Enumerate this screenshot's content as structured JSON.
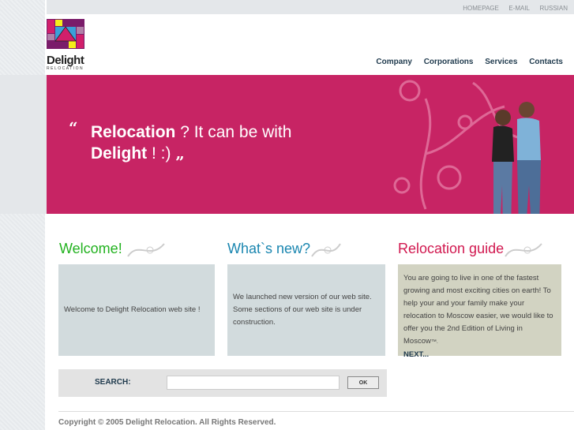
{
  "top_links": [
    "HOMEPAGE",
    "E-MAIL",
    "RUSSIAN"
  ],
  "brand": {
    "name": "Delight",
    "sub": "RELOCATION"
  },
  "nav": [
    "Company",
    "Corporations",
    "Services",
    "Contacts"
  ],
  "banner": {
    "open_quote": "“",
    "word1": "Relocation",
    "rest1": " ? It can be with",
    "word2": "Delight",
    "rest2": " !  :)",
    "close_quote": "„"
  },
  "columns": [
    {
      "title": "Welcome!",
      "color": "#22b21f",
      "text": "Welcome to Delight Relocation web site !"
    },
    {
      "title": "What`s new?",
      "color": "#1a86b0",
      "text": "We launched new version of our web site. Some sections of our web site is under construction."
    },
    {
      "title": "Relocation guide",
      "color": "#d1184f",
      "text": "You are going to live in one of the fastest growing and most exciting cities on earth! To help your and your family make your relocation to Moscow easier, we would like to offer you the 2nd Edition of Living in Moscow",
      "mark": "™.",
      "next": "NEXT..."
    }
  ],
  "search": {
    "label": "SEARCH:",
    "value": "",
    "button": "OK"
  },
  "footer": "Copyright © 2005 Delight Relocation. All Rights Reserved."
}
